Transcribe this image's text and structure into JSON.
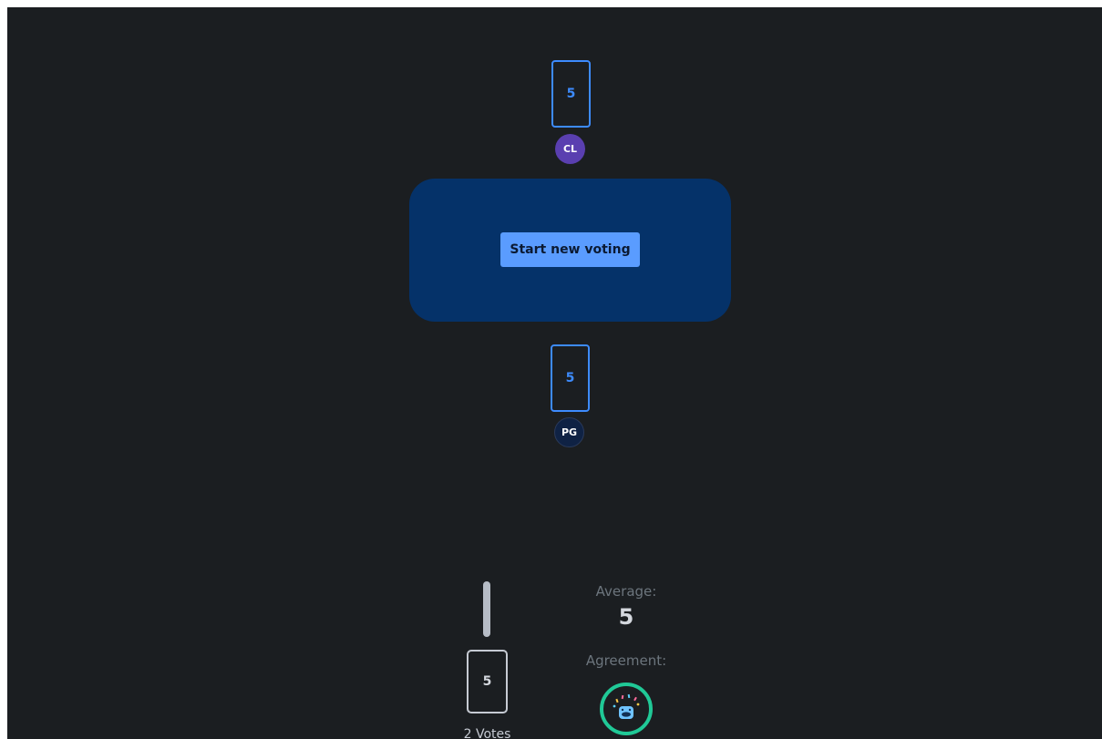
{
  "players": [
    {
      "initials": "CL",
      "card_value": "5",
      "avatar_color": "#5a3fb0"
    },
    {
      "initials": "PG",
      "card_value": "5",
      "avatar_color": "#0f2244"
    }
  ],
  "table": {
    "button_label": "Start new voting"
  },
  "results": {
    "card_value": "5",
    "votes_label": "2 Votes",
    "vote_share": 1.0,
    "average_label": "Average:",
    "average_value": "5",
    "agreement_label": "Agreement:",
    "agreement_icon": "party-face-icon",
    "agreement_color": "#20c997"
  },
  "colors": {
    "background": "#1b1e21",
    "table": "#053269",
    "accent": "#3d8bfd",
    "button": "#5a9cff"
  }
}
